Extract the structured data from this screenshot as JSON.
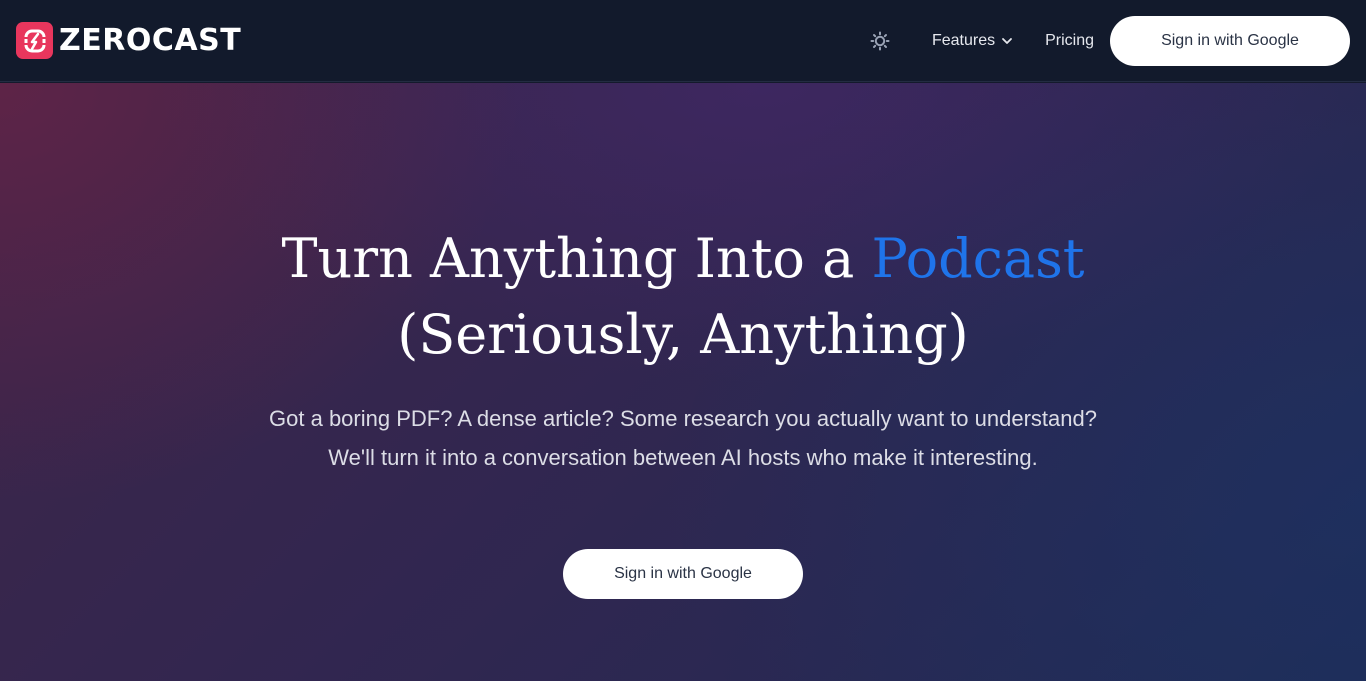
{
  "brand": {
    "name": "ZEROCAST",
    "logo_icon": "zerocast-logo-icon",
    "color": "#e8365d"
  },
  "nav": {
    "theme_icon": "sun-icon",
    "features_label": "Features",
    "features_icon": "chevron-down-icon",
    "pricing_label": "Pricing",
    "signin_label": "Sign in with Google"
  },
  "hero": {
    "title_line1": "Turn Anything Into a",
    "title_accent": "Podcast",
    "title_line2": "(Seriously, Anything)",
    "subtitle": "Got a boring PDF? A dense article? Some research you actually want to understand? We'll turn it into a conversation between AI hosts who make it interesting.",
    "cta_label": "Sign in with Google"
  },
  "colors": {
    "accent": "#1f74ea",
    "nav_bg": "#121a2c"
  }
}
